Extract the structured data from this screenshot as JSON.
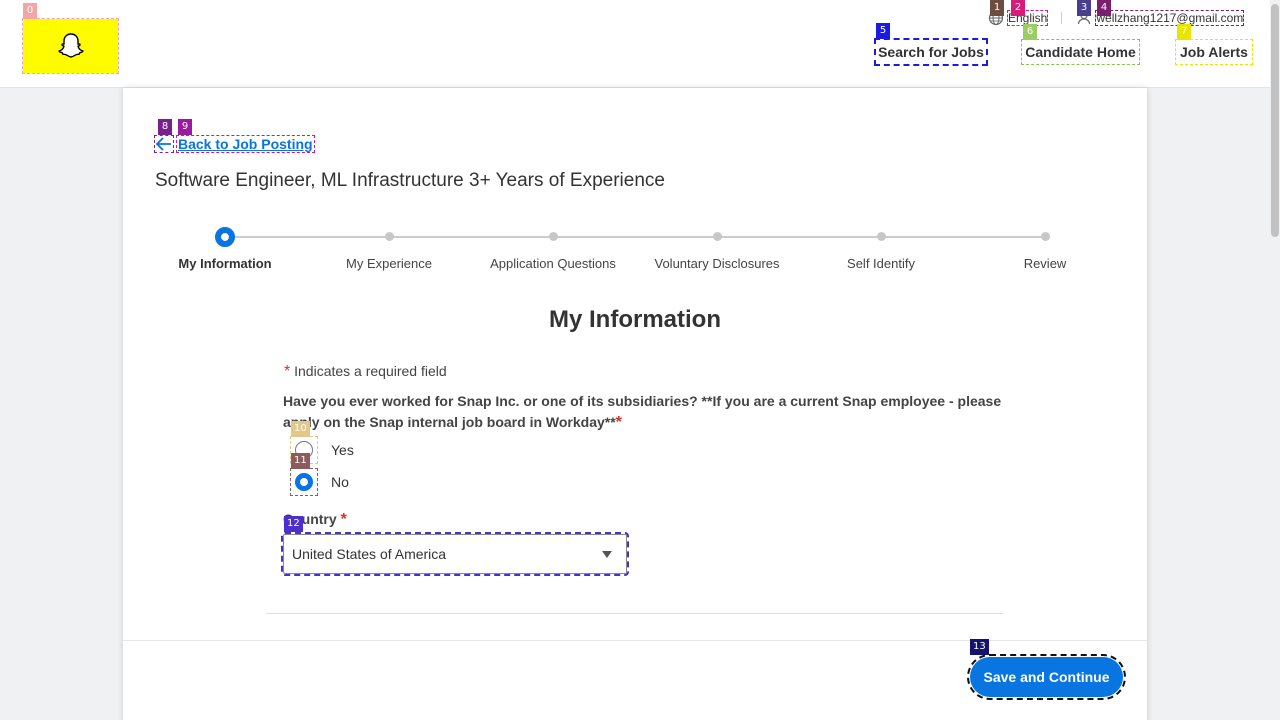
{
  "header": {
    "language": "English",
    "user_email": "wellzhang1217@gmail.com",
    "nav": {
      "search_jobs": "Search for Jobs",
      "candidate_home": "Candidate Home",
      "job_alerts": "Job Alerts"
    }
  },
  "back_link": "Back to Job Posting",
  "job_title": "Software Engineer, ML Infrastructure 3+ Years of Experience",
  "steps": [
    {
      "label": "My Information",
      "active": true
    },
    {
      "label": "My Experience",
      "active": false
    },
    {
      "label": "Application Questions",
      "active": false
    },
    {
      "label": "Voluntary Disclosures",
      "active": false
    },
    {
      "label": "Self Identify",
      "active": false
    },
    {
      "label": "Review",
      "active": false
    }
  ],
  "section_title": "My Information",
  "required_note": "Indicates a required field",
  "required_marker": "*",
  "question": {
    "text": "Have you ever worked for Snap Inc. or one of its subsidiaries? **If you are a current Snap employee - please apply on the Snap internal job board in Workday**",
    "options": [
      {
        "label": "Yes",
        "selected": false
      },
      {
        "label": "No",
        "selected": true
      }
    ]
  },
  "country": {
    "label": "Country",
    "value": "United States of America"
  },
  "save_button": "Save and Continue",
  "markers": [
    "0",
    "1",
    "2",
    "3",
    "4",
    "5",
    "6",
    "7",
    "8",
    "9",
    "10",
    "11",
    "12",
    "13"
  ],
  "colors": {
    "brand_yellow": "#fffc00",
    "accent_blue": "#0875e1",
    "required_red": "#de2e21"
  }
}
